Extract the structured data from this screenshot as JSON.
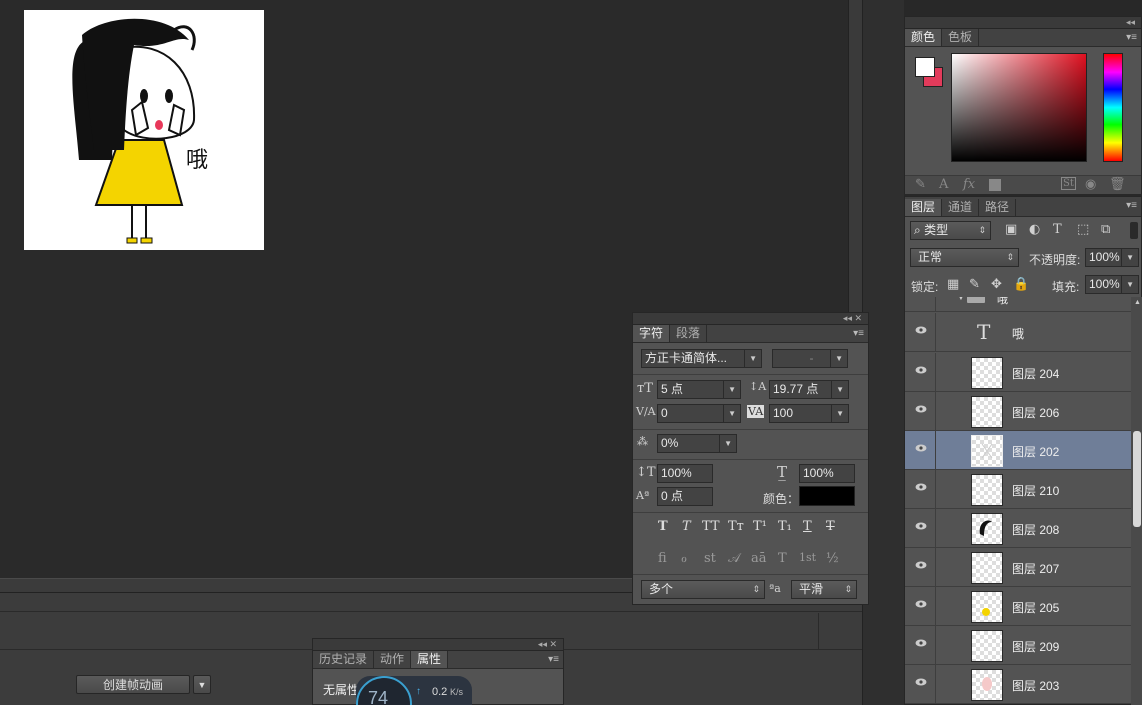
{
  "timeline": {
    "create_button_label": "创建帧动画"
  },
  "history_panel": {
    "tabs": [
      "历史记录",
      "动作",
      "属性"
    ],
    "active_tab": 2,
    "content_label": "无属性"
  },
  "net_widget": {
    "percent": "74",
    "speed": "0.2",
    "unit": "K/s"
  },
  "character_panel": {
    "tabs": [
      "字符",
      "段落"
    ],
    "font_family": "方正卡通简体...",
    "font_style": "-",
    "font_size": "5 点",
    "leading": "19.77 点",
    "kerning": "0",
    "tracking": "100",
    "tsume": "0%",
    "vertical_scale": "100%",
    "horizontal_scale": "100%",
    "baseline_shift": "0 点",
    "color_label": "颜色：",
    "color_value": "#000000",
    "language": "多个",
    "antialias": "平滑",
    "aa_icon_text": "ªa",
    "style_buttons": [
      "T",
      "T",
      "TT",
      "Tт",
      "T¹",
      "T₁",
      "T",
      "T"
    ],
    "opentype_buttons": [
      "fi",
      "ℴ",
      "st",
      "𝒜",
      "aā",
      "T",
      "1st",
      "½"
    ]
  },
  "color_panel": {
    "tabs": [
      "颜色",
      "色板"
    ],
    "foreground": "#ffffff",
    "background": "#e23b5b"
  },
  "layers_panel": {
    "tabs": [
      "图层",
      "通道",
      "路径"
    ],
    "filter_kind": "类型",
    "blend_mode": "正常",
    "opacity_label": "不透明度:",
    "opacity_value": "100%",
    "lock_label": "锁定:",
    "fill_label": "填充:",
    "fill_value": "100%",
    "group_name": "哦",
    "text_layer_name": "哦",
    "layers": [
      {
        "name": "图层 204",
        "selected": false
      },
      {
        "name": "图层 206",
        "selected": false
      },
      {
        "name": "图层 202",
        "selected": true
      },
      {
        "name": "图层 210",
        "selected": false
      },
      {
        "name": "图层 208",
        "selected": false
      },
      {
        "name": "图层 207",
        "selected": false
      },
      {
        "name": "图层 205",
        "selected": false
      },
      {
        "name": "图层 209",
        "selected": false
      },
      {
        "name": "图层 203",
        "selected": false
      }
    ]
  },
  "document": {
    "caption_text": "哦"
  }
}
